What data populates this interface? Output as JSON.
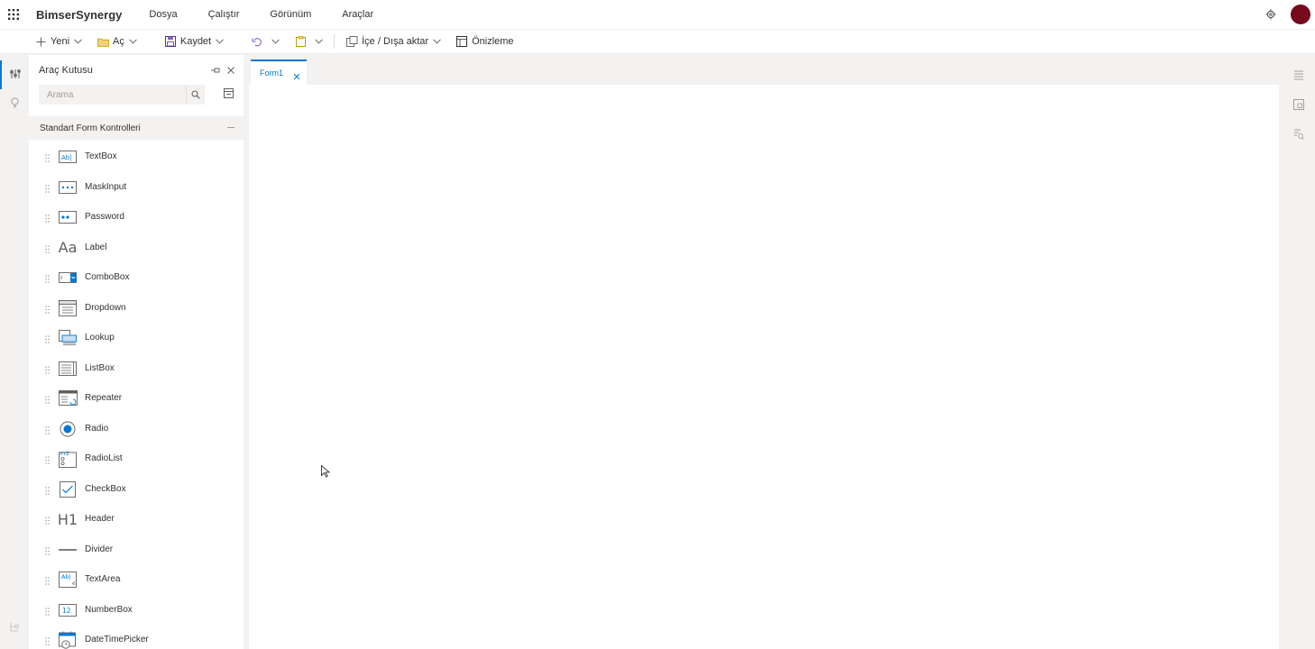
{
  "app": {
    "brand": "BimserSynergy",
    "menu": [
      "Dosya",
      "Çalıştır",
      "Görünüm",
      "Araçlar"
    ]
  },
  "toolbar": {
    "new_label": "Yeni",
    "open_label": "Aç",
    "save_label": "Kaydet",
    "import_export_label": "İçe / Dışa aktar",
    "preview_label": "Önizleme"
  },
  "toolbox": {
    "title": "Araç Kutusu",
    "search_placeholder": "Arama",
    "section_title": "Standart Form Kontrolleri",
    "items": [
      {
        "label": "TextBox",
        "icon": "textbox-icon"
      },
      {
        "label": "MaskInput",
        "icon": "maskinput-icon"
      },
      {
        "label": "Password",
        "icon": "password-icon"
      },
      {
        "label": "Label",
        "icon": "label-icon"
      },
      {
        "label": "ComboBox",
        "icon": "combobox-icon"
      },
      {
        "label": "Dropdown",
        "icon": "dropdown-icon"
      },
      {
        "label": "Lookup",
        "icon": "lookup-icon"
      },
      {
        "label": "ListBox",
        "icon": "listbox-icon"
      },
      {
        "label": "Repeater",
        "icon": "repeater-icon"
      },
      {
        "label": "Radio",
        "icon": "radio-icon"
      },
      {
        "label": "RadioList",
        "icon": "radiolist-icon"
      },
      {
        "label": "CheckBox",
        "icon": "checkbox-icon"
      },
      {
        "label": "Header",
        "icon": "header-icon"
      },
      {
        "label": "Divider",
        "icon": "divider-icon"
      },
      {
        "label": "TextArea",
        "icon": "textarea-icon"
      },
      {
        "label": "NumberBox",
        "icon": "numberbox-icon"
      },
      {
        "label": "DateTimePicker",
        "icon": "datetimepicker-icon"
      }
    ]
  },
  "document": {
    "tab_label": "Form1"
  },
  "icon_glyphs": {
    "label": "Aa",
    "header": "H1",
    "textbox": "Ab|",
    "textarea": "Ab|",
    "numberbox": "12",
    "radiolist": "XYZ"
  },
  "colors": {
    "accent": "#0078d4",
    "avatar": "#750b1c",
    "background": "#f3f2f1",
    "surface": "#ffffff",
    "text": "#323130"
  }
}
